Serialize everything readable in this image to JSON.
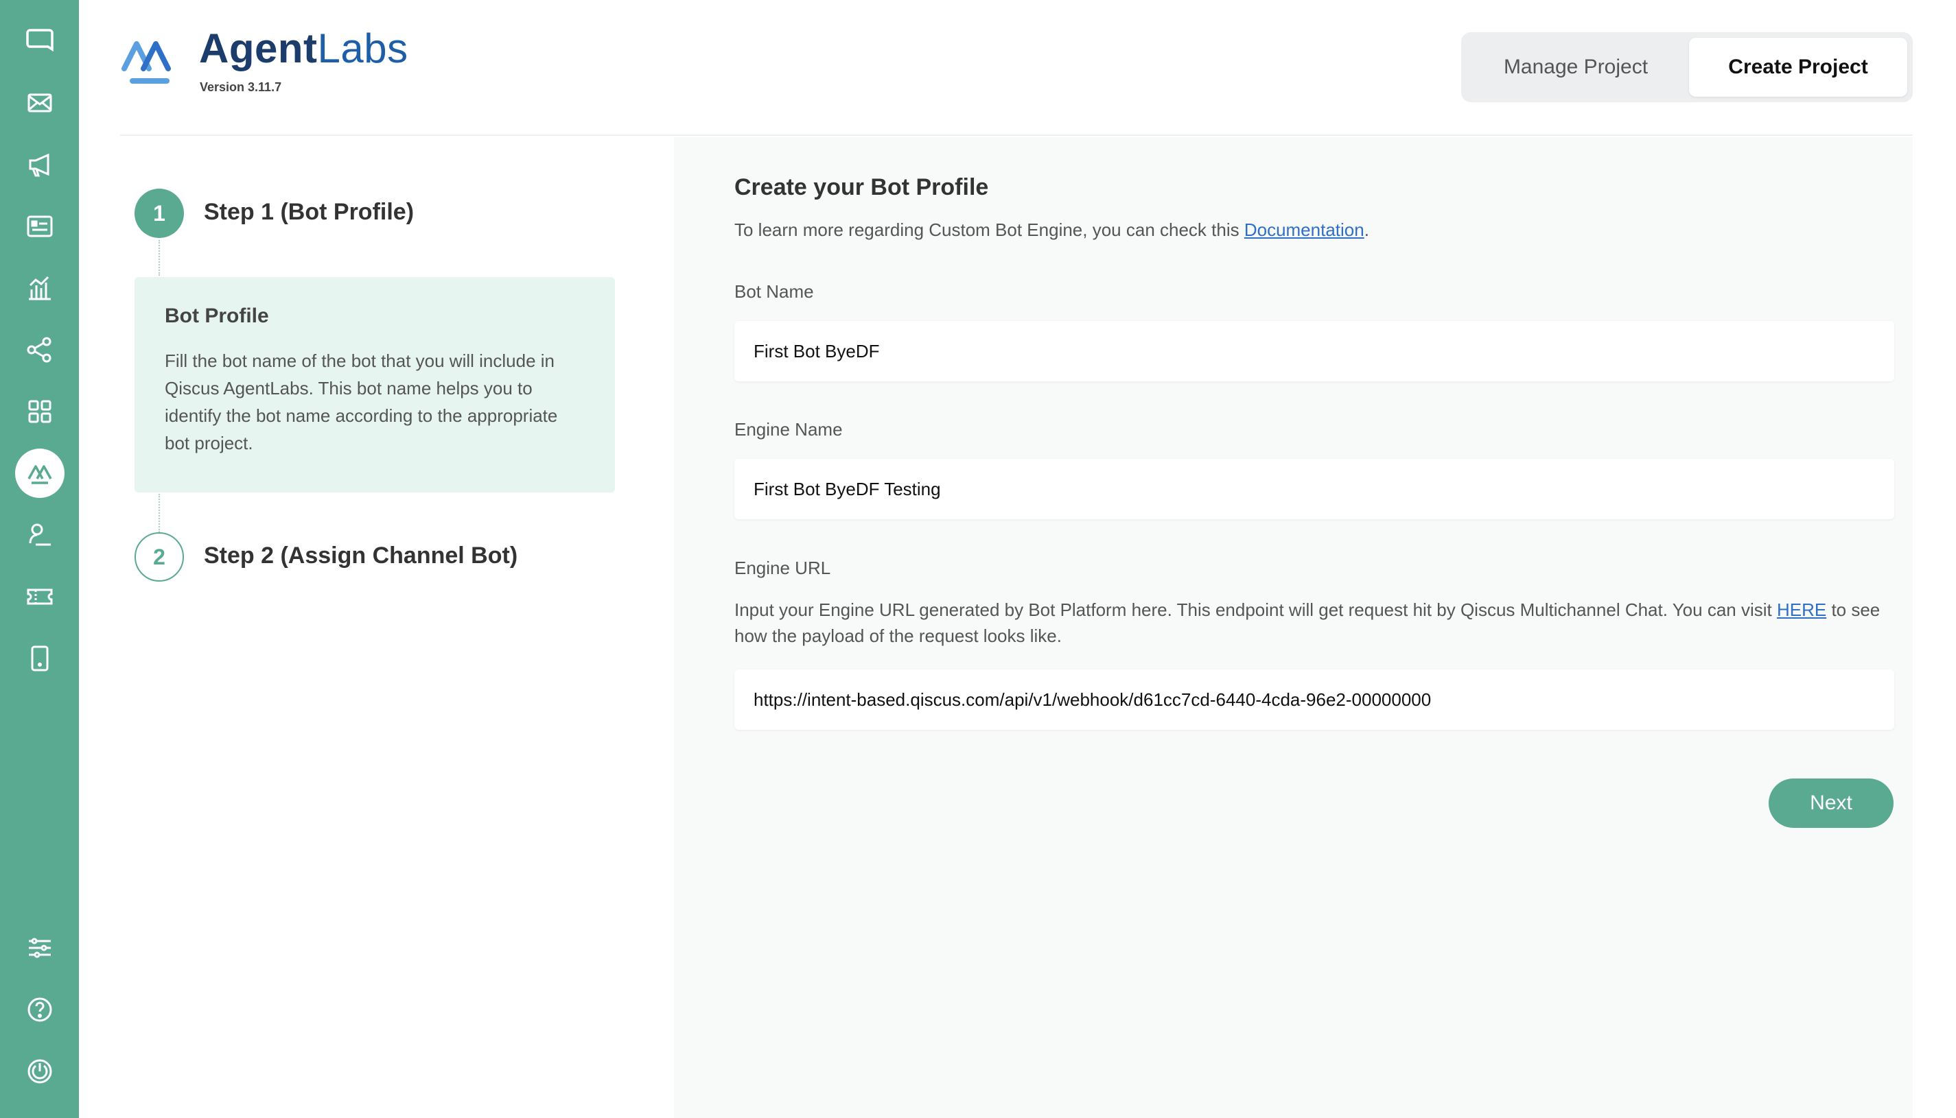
{
  "app": {
    "brand_bold": "Agent",
    "brand_light": "Labs",
    "version": "Version 3.11.7",
    "accent_color": "#5aaa91"
  },
  "sidebar": {
    "top_items": [
      {
        "icon": "chat-bubble-icon"
      },
      {
        "icon": "mail-icon"
      },
      {
        "icon": "megaphone-icon"
      },
      {
        "icon": "contact-card-icon"
      },
      {
        "icon": "analytics-icon"
      },
      {
        "icon": "share-nodes-icon"
      },
      {
        "icon": "apps-grid-icon"
      },
      {
        "icon": "agentlabs-icon",
        "active": true
      },
      {
        "icon": "agent-profile-icon"
      },
      {
        "icon": "ticket-icon"
      },
      {
        "icon": "mobile-icon"
      }
    ],
    "bottom_items": [
      {
        "icon": "settings-sliders-icon"
      },
      {
        "icon": "help-icon"
      },
      {
        "icon": "power-icon"
      }
    ]
  },
  "tabs": [
    {
      "label": "Manage Project",
      "active": false
    },
    {
      "label": "Create Project",
      "active": true
    }
  ],
  "steps": [
    {
      "number": "1",
      "title": "Step 1 (Bot Profile)",
      "active": true
    },
    {
      "number": "2",
      "title": "Step 2 (Assign Channel Bot)",
      "active": false
    }
  ],
  "info_card": {
    "title": "Bot Profile",
    "body": "Fill the bot name of the bot that you will include in Qiscus AgentLabs. This bot name helps you to identify the bot name according to the appropriate bot project."
  },
  "form": {
    "title": "Create your Bot Profile",
    "subtitle_prefix": "To learn more regarding Custom Bot Engine, you can check this ",
    "subtitle_link": "Documentation",
    "subtitle_suffix": ".",
    "bot_name": {
      "label": "Bot Name",
      "value": "First Bot ByeDF"
    },
    "engine_name": {
      "label": "Engine Name",
      "value": "First Bot ByeDF Testing"
    },
    "engine_url": {
      "label": "Engine URL",
      "desc_prefix": "Input your Engine URL generated by Bot Platform here. This endpoint will get request hit by Qiscus Multichannel Chat. You can visit ",
      "desc_link": "HERE",
      "desc_suffix": " to see how the payload of the request looks like.",
      "value": "https://intent-based.qiscus.com/api/v1/webhook/d61cc7cd-6440-4cda-96e2-00000000"
    },
    "next_label": "Next"
  }
}
